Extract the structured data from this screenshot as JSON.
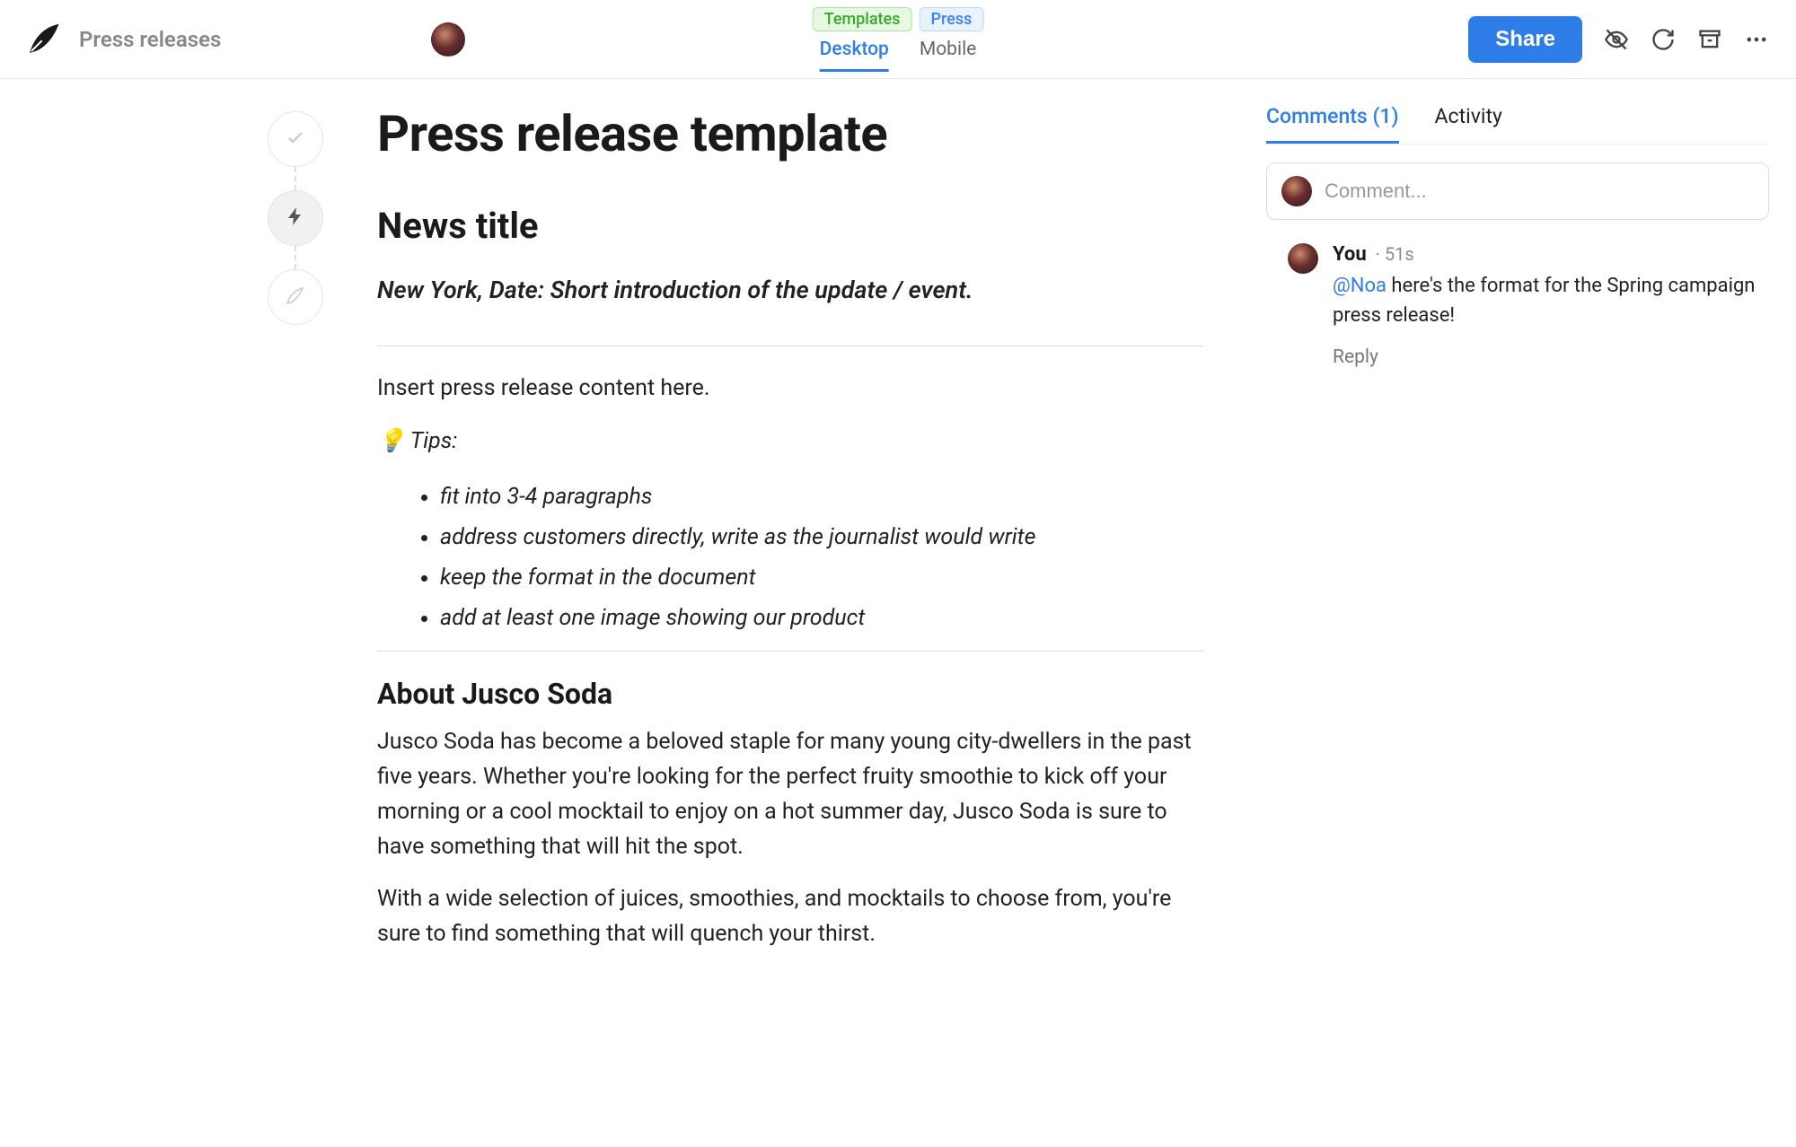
{
  "header": {
    "brand_text": "Press releases",
    "tags": [
      "Templates",
      "Press"
    ],
    "device_tabs": {
      "desktop": "Desktop",
      "mobile": "Mobile"
    },
    "share_label": "Share"
  },
  "document": {
    "title": "Press release template",
    "section_title": "News title",
    "intro": "New York, Date: Short introduction of the update / event.",
    "content_placeholder": "Insert press release content here.",
    "tips_label": "💡 Tips:",
    "tips": [
      "fit into 3-4 paragraphs",
      "address customers directly, write as the journalist would write",
      "keep the format in the document",
      "add at least one image showing our product"
    ],
    "about_heading": "About Jusco Soda",
    "about_p1": "Jusco Soda has become a beloved staple for many young city-dwellers in the past five years. Whether you're looking for the perfect fruity smoothie to kick off your morning or a cool mocktail to enjoy on a hot summer day, Jusco Soda is sure to have something that will hit the spot.",
    "about_p2": "With a wide selection of juices, smoothies, and mocktails to choose from, you're sure to find something that will quench your thirst."
  },
  "side": {
    "tabs": {
      "comments": "Comments (1)",
      "activity": "Activity"
    },
    "comment_placeholder": "Comment...",
    "comment": {
      "author": "You",
      "time": "· 51s",
      "mention": "@Noa",
      "text_rest": " here's the format for the Spring campaign press release!",
      "reply": "Reply"
    }
  }
}
